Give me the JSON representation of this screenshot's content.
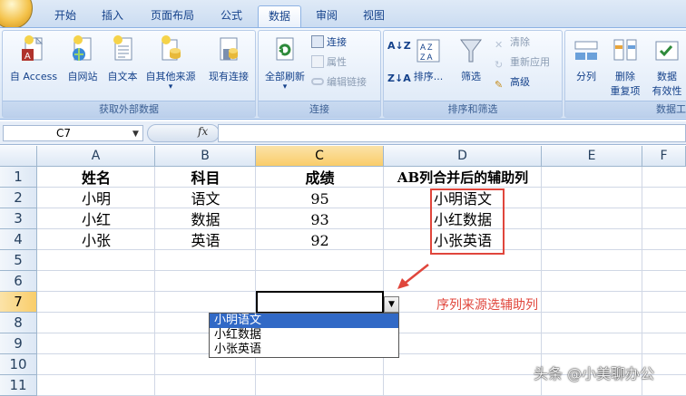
{
  "ribbon": {
    "tabs": [
      "开始",
      "插入",
      "页面布局",
      "公式",
      "数据",
      "审阅",
      "视图"
    ],
    "active_tab": "数据",
    "groups": {
      "external": {
        "label": "获取外部数据",
        "buttons": [
          "自 Access",
          "自网站",
          "自文本",
          "自其他来源",
          "现有连接"
        ]
      },
      "connections": {
        "label": "连接",
        "refresh_all": "全部刷新",
        "connections": "连接",
        "properties": "属性",
        "edit_links": "编辑链接"
      },
      "sort_filter": {
        "label": "排序和筛选",
        "sort": "排序...",
        "filter": "筛选",
        "clear": "清除",
        "reapply": "重新应用",
        "advanced": "高级"
      },
      "data_tools": {
        "label": "数据工",
        "text_to_columns": "分列",
        "remove_duplicates_1": "删除",
        "remove_duplicates_2": "重复项",
        "data_validation_1": "数据",
        "data_validation_2": "有效性"
      }
    }
  },
  "formula_bar": {
    "name_box": "C7",
    "fx": "fx",
    "content": ""
  },
  "sheet": {
    "columns": [
      "A",
      "B",
      "C",
      "D",
      "E",
      "F"
    ],
    "selected_column": "C",
    "rows": [
      "1",
      "2",
      "3",
      "4",
      "5",
      "6",
      "7",
      "8",
      "9",
      "10",
      "11"
    ],
    "selected_row": "7",
    "header": [
      "姓名",
      "科目",
      "成绩",
      "AB列合并后的辅助列"
    ],
    "data": [
      [
        "小明",
        "语文",
        "95",
        "小明语文"
      ],
      [
        "小红",
        "数据",
        "93",
        "小红数据"
      ],
      [
        "小张",
        "英语",
        "92",
        "小张英语"
      ]
    ]
  },
  "dropdown": {
    "options": [
      "小明语文",
      "小红数据",
      "小张英语"
    ],
    "highlighted": "小明语文"
  },
  "annotation": {
    "note": "序列来源选辅助列",
    "color": "#e0463c"
  },
  "watermark": "头条 @小美聊办公"
}
